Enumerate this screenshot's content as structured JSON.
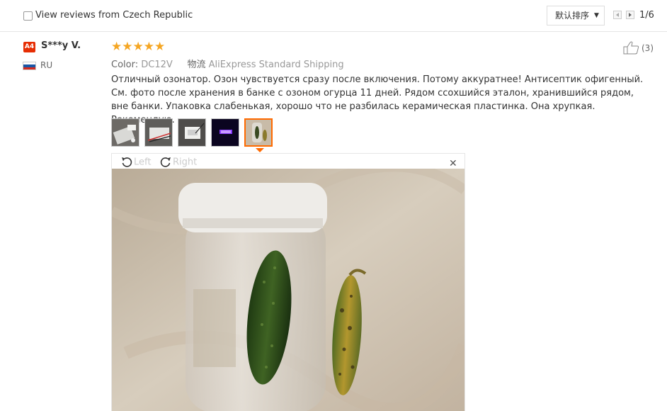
{
  "filter": {
    "checkbox_label": "View reviews from Czech Republic"
  },
  "sort": {
    "label": "默认排序"
  },
  "pagination": {
    "count": "1/6"
  },
  "review": {
    "avatar_badge": "A4",
    "username": "S***y V.",
    "country": "RU",
    "rating": 5,
    "stars": "★★★★★",
    "color_key": "Color:",
    "color_value": "DC12V",
    "shipping_key": "物流",
    "shipping_value": "AliExpress Standard Shipping",
    "helpful_count": "(3)",
    "text": "Отличный озонатор. Озон чувствуется сразу после включения. Потому аккуратнее! Антисептик офигенный. См. фото после хранения в банке с озоном огурца 11 дней. Рядом ссохшийся эталон, хранившийся рядом, вне банки. Упаковка слабенькая, хорошо что не разбилась керамическая пластинка. Она хрупкая. Рекомендую.",
    "thumbnails": [
      "thumb-1",
      "thumb-2",
      "thumb-3",
      "thumb-4",
      "thumb-5"
    ],
    "active_thumbnail": 5
  },
  "viewer": {
    "rotate_left_label": "Left",
    "rotate_right_label": "Right",
    "close_glyph": "✕"
  },
  "colors": {
    "accent": "#ff6a00",
    "stars": "#f5a623",
    "badge": "#e62e04"
  }
}
